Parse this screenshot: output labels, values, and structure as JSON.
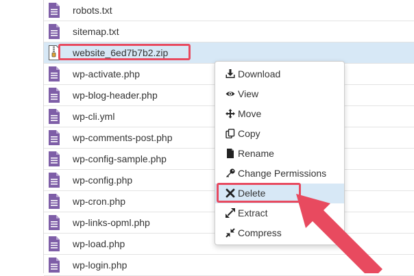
{
  "files": [
    {
      "name": "robots.txt",
      "icon": "file-text-icon"
    },
    {
      "name": "sitemap.txt",
      "icon": "file-text-icon"
    },
    {
      "name": "website_6ed7b7b2.zip",
      "icon": "zip-file-icon"
    },
    {
      "name": "wp-activate.php",
      "icon": "file-text-icon"
    },
    {
      "name": "wp-blog-header.php",
      "icon": "file-text-icon"
    },
    {
      "name": "wp-cli.yml",
      "icon": "file-text-icon"
    },
    {
      "name": "wp-comments-post.php",
      "icon": "file-text-icon"
    },
    {
      "name": "wp-config-sample.php",
      "icon": "file-text-icon"
    },
    {
      "name": "wp-config.php",
      "icon": "file-text-icon"
    },
    {
      "name": "wp-cron.php",
      "icon": "file-text-icon"
    },
    {
      "name": "wp-links-opml.php",
      "icon": "file-text-icon"
    },
    {
      "name": "wp-load.php",
      "icon": "file-text-icon"
    },
    {
      "name": "wp-login.php",
      "icon": "file-text-icon"
    }
  ],
  "selected_file": "website_6ed7b7b2.zip",
  "context_menu": {
    "items": [
      {
        "label": "Download",
        "icon": "download-icon"
      },
      {
        "label": "View",
        "icon": "eye-icon"
      },
      {
        "label": "Move",
        "icon": "move-icon"
      },
      {
        "label": "Copy",
        "icon": "copy-icon"
      },
      {
        "label": "Rename",
        "icon": "file-icon"
      },
      {
        "label": "Change Permissions",
        "icon": "key-icon"
      },
      {
        "label": "Delete",
        "icon": "close-icon"
      },
      {
        "label": "Extract",
        "icon": "expand-icon"
      },
      {
        "label": "Compress",
        "icon": "compress-icon"
      }
    ],
    "active_item": "Delete"
  },
  "colors": {
    "file_icon": "#7e5ea7",
    "highlight": "#e84a5f",
    "selection_bg": "#d7e8f6"
  }
}
